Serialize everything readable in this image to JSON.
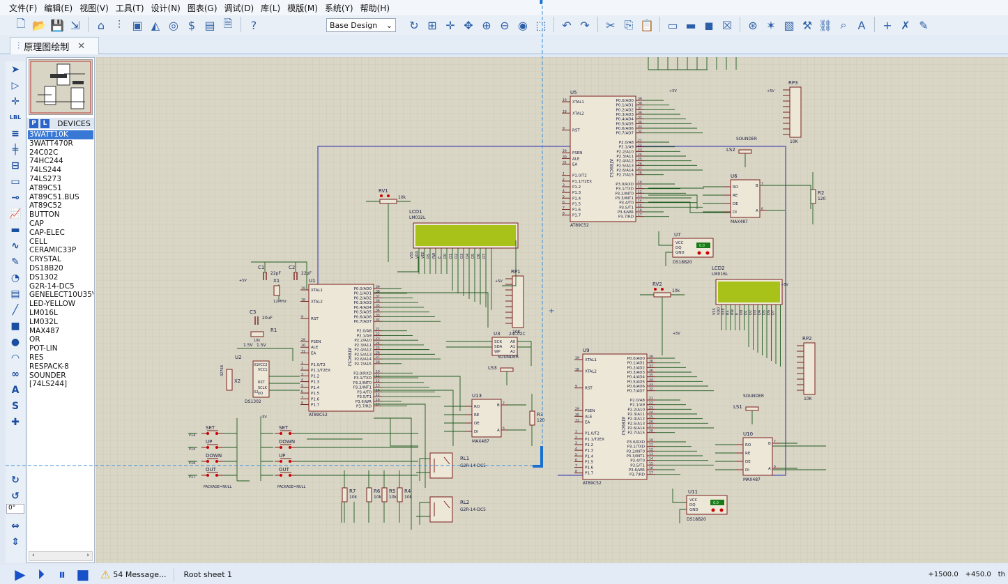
{
  "menu": [
    "文件(F)",
    "编辑(E)",
    "视图(V)",
    "工具(T)",
    "设计(N)",
    "图表(G)",
    "调试(D)",
    "库(L)",
    "模版(M)",
    "系统(Y)",
    "帮助(H)"
  ],
  "toolbar": {
    "design_select": "Base Design",
    "left_icons": [
      "new-file",
      "open-folder",
      "save",
      "import",
      "home",
      "schematic",
      "pcb",
      "3d",
      "gerber",
      "bom",
      "source",
      "file",
      "help"
    ],
    "right_icons": [
      "refresh",
      "grid",
      "origin",
      "pan",
      "zoom-in",
      "zoom-out",
      "zoom-all",
      "zoom-area",
      "undo",
      "redo",
      "cut",
      "copy",
      "paste",
      "block-copy",
      "block-move",
      "block-rotate",
      "block-delete",
      "pick",
      "make-device",
      "packaging",
      "decompose",
      "wire-autorouter",
      "search",
      "property-assign",
      "new-sheet",
      "delete-sheet",
      "netlist"
    ]
  },
  "tab": {
    "label": "原理图绘制",
    "close": "✕"
  },
  "left_tools": [
    "select",
    "component",
    "junction",
    "wire-label",
    "text-script",
    "bus",
    "subcircuit",
    "terminal",
    "device-pin",
    "graph",
    "tape",
    "generator",
    "voltage-probe",
    "current-probe",
    "virtual-instrument",
    "line",
    "box",
    "circle",
    "arc",
    "path",
    "text",
    "symbol",
    "marker"
  ],
  "rotation": {
    "angle": "0°"
  },
  "devices": {
    "header": "DEVICES",
    "p": "P",
    "l": "L",
    "selected": "3WATT10K",
    "items": [
      "3WATT10K",
      "3WATT470R",
      "24C02C",
      "74HC244",
      "74LS244",
      "74LS273",
      "AT89C51",
      "AT89C51.BUS",
      "AT89C52",
      "BUTTON",
      "CAP",
      "CAP-ELEC",
      "CELL",
      "CERAMIC33P",
      "CRYSTAL",
      "DS18B20",
      "DS1302",
      "G2R-14-DC5",
      "GENELECT10U35V",
      "LED-YELLOW",
      "LM016L",
      "LM032L",
      "MAX487",
      "OR",
      "POT-LIN",
      "RES",
      "RESPACK-8",
      "SOUNDER",
      "[74LS244]"
    ]
  },
  "schematic": {
    "mcu_pins": {
      "left": [
        "XTAL1",
        "",
        "XTAL2",
        "",
        "",
        "RST",
        "",
        "",
        "",
        "PSEN",
        "ALE",
        "EA",
        "",
        "P1.0/T2",
        "P1.1/T2EX",
        "P1.2",
        "P1.3",
        "P1.4",
        "P1.5",
        "P1.6",
        "P1.7"
      ],
      "left_nums": [
        "19",
        "",
        "18",
        "",
        "",
        "9",
        "",
        "",
        "",
        "29",
        "30",
        "31",
        "",
        "1",
        "2",
        "3",
        "4",
        "5",
        "6",
        "7",
        "8"
      ],
      "right": [
        "P0.0/AD0",
        "P0.1/AD1",
        "P0.2/AD2",
        "P0.3/AD3",
        "P0.4/AD4",
        "P0.5/AD5",
        "P0.6/AD6",
        "P0.7/AD7",
        "",
        "P2.0/A8",
        "P2.1/A9",
        "P2.2/A10",
        "P2.3/A11",
        "P2.4/A12",
        "P2.5/A13",
        "P2.6/A14",
        "P2.7/A15",
        "",
        "P3.0/RXD",
        "P3.1/TXD",
        "P3.2/INT0",
        "P3.3/INT1",
        "P3.4/T0",
        "P3.5/T1",
        "P3.6/WR",
        "P3.7/RD"
      ],
      "right_nums": [
        "39",
        "38",
        "37",
        "36",
        "35",
        "34",
        "33",
        "32",
        "",
        "21",
        "22",
        "23",
        "24",
        "25",
        "26",
        "27",
        "28",
        "",
        "10",
        "11",
        "12",
        "13",
        "14",
        "15",
        "16",
        "17"
      ]
    },
    "chips": [
      {
        "id": "U1",
        "part": "AT89C52"
      },
      {
        "id": "U5",
        "part": "AT89C52"
      },
      {
        "id": "U9",
        "part": "AT89C52"
      }
    ],
    "max487_pins": {
      "left": [
        "RO",
        "RE",
        "DE",
        "DI"
      ],
      "right": [
        "B",
        "A"
      ],
      "right_nums": [
        "7",
        "6"
      ]
    },
    "max487": [
      {
        "id": "U6",
        "part": "MAX487"
      },
      {
        "id": "U10",
        "part": "MAX487"
      },
      {
        "id": "U13",
        "part": "MAX487"
      }
    ],
    "ds18b20_pins": [
      "VCC",
      "DQ",
      "GND"
    ],
    "ds18b20": [
      {
        "id": "U7",
        "part": "DS18B20",
        "value": "0.0"
      },
      {
        "id": "U11",
        "part": "DS18B20",
        "value": "0.0"
      }
    ],
    "eeprom": {
      "id": "U3",
      "part": "24C02C",
      "pins": [
        "SCK",
        "SDA",
        "WP",
        "A0",
        "A1",
        "A2"
      ]
    },
    "rtc": {
      "id": "U2",
      "part": "DS1302",
      "pins": [
        "X1",
        "VCC2",
        "VCC1",
        "X2",
        "RST",
        "SCLK",
        "I/O"
      ]
    },
    "lcds": [
      {
        "id": "LCD1",
        "part": "LM032L"
      },
      {
        "id": "LCD2",
        "part": "LM016L"
      }
    ],
    "lcd_pins": [
      "VSS",
      "VDD",
      "VEE",
      "RS",
      "RW",
      "E",
      "D0",
      "D1",
      "D2",
      "D3",
      "D4",
      "D5",
      "D6",
      "D7"
    ],
    "respacks": [
      {
        "id": "RP1",
        "value": "10K"
      },
      {
        "id": "RP2",
        "value": "10K"
      },
      {
        "id": "RP3",
        "value": "10K"
      }
    ],
    "resistors": [
      {
        "id": "R1",
        "value": "10k"
      },
      {
        "id": "R2",
        "value": "120"
      },
      {
        "id": "R3",
        "value": "120"
      },
      {
        "id": "R4",
        "value": "10k"
      },
      {
        "id": "R5",
        "value": "10k"
      },
      {
        "id": "R6",
        "value": "10k"
      },
      {
        "id": "R7",
        "value": "10k"
      }
    ],
    "pots": [
      {
        "id": "RV1",
        "value": "10k"
      },
      {
        "id": "RV2",
        "value": "10k"
      }
    ],
    "caps": [
      {
        "id": "C1",
        "value": "22pF"
      },
      {
        "id": "C2",
        "value": "22pF"
      },
      {
        "id": "C3",
        "value": "20uF"
      }
    ],
    "crystals": [
      {
        "id": "X1",
        "value": "12MHz"
      },
      {
        "id": "X2",
        "value": "32768"
      }
    ],
    "sounders": [
      {
        "id": "LS1",
        "part": "SOUNDER"
      },
      {
        "id": "LS2",
        "part": "SOUNDER"
      },
      {
        "id": "LS3",
        "part": "SOUNDER"
      }
    ],
    "relays": [
      {
        "id": "RL1",
        "part": "G2R-14-DC5"
      },
      {
        "id": "RL2",
        "part": "G2R-14-DC5"
      }
    ],
    "buttons_left": [
      "SET",
      "UP",
      "DOWN",
      "OUT"
    ],
    "buttons_right": [
      "SET",
      "DOWN",
      "UP",
      "OUT"
    ],
    "button_package": "PACKAGE=NULL",
    "cell": "1.5V",
    "power": "+5V",
    "net_labels": [
      "P14",
      "P15",
      "P16",
      "P17"
    ]
  },
  "status": {
    "message": "54 Message...",
    "sheet": "Root sheet 1",
    "x": "+1500.0",
    "y": "+450.0",
    "unit": "th"
  },
  "colors": {
    "wire": "#1e5b1e",
    "bus_wire": "#2a2ab0",
    "body": "#7a1f1f",
    "lcd": "#a9c21a",
    "canvas": "#d9d6c6",
    "accent": "#1750c8"
  }
}
